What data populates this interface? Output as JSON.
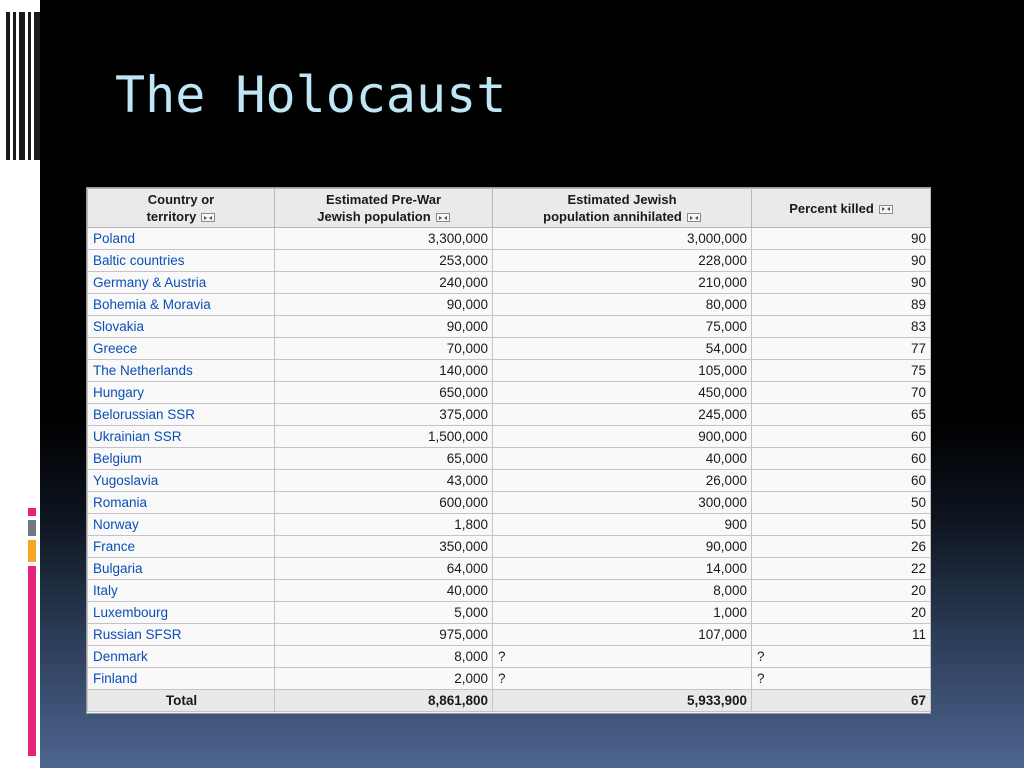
{
  "slide": {
    "title": "The Holocaust",
    "colors": {
      "title": "#bfe6f4",
      "accent_gray": "#6e7782",
      "accent_orange": "#f5a623",
      "accent_pink": "#e8247a",
      "link": "#0b4fb6"
    }
  },
  "table": {
    "headers": [
      {
        "line1": "Country or",
        "line2": "territory",
        "sortable": true
      },
      {
        "line1": "Estimated Pre-War",
        "line2": "Jewish population",
        "sortable": true
      },
      {
        "line1": "Estimated Jewish",
        "line2": "population annihilated",
        "sortable": true
      },
      {
        "line1": "Percent killed",
        "line2": "",
        "sortable": true
      }
    ],
    "sort_icon": "sort-toggle-icon",
    "rows": [
      {
        "country": "Poland",
        "prewar": "3,300,000",
        "annihilated": "3,000,000",
        "percent": "90"
      },
      {
        "country": "Baltic countries",
        "prewar": "253,000",
        "annihilated": "228,000",
        "percent": "90"
      },
      {
        "country": "Germany & Austria",
        "prewar": "240,000",
        "annihilated": "210,000",
        "percent": "90"
      },
      {
        "country": "Bohemia & Moravia",
        "prewar": "90,000",
        "annihilated": "80,000",
        "percent": "89"
      },
      {
        "country": "Slovakia",
        "prewar": "90,000",
        "annihilated": "75,000",
        "percent": "83"
      },
      {
        "country": "Greece",
        "prewar": "70,000",
        "annihilated": "54,000",
        "percent": "77"
      },
      {
        "country": "The Netherlands",
        "prewar": "140,000",
        "annihilated": "105,000",
        "percent": "75"
      },
      {
        "country": "Hungary",
        "prewar": "650,000",
        "annihilated": "450,000",
        "percent": "70"
      },
      {
        "country": "Belorussian SSR",
        "prewar": "375,000",
        "annihilated": "245,000",
        "percent": "65"
      },
      {
        "country": "Ukrainian SSR",
        "prewar": "1,500,000",
        "annihilated": "900,000",
        "percent": "60"
      },
      {
        "country": "Belgium",
        "prewar": "65,000",
        "annihilated": "40,000",
        "percent": "60"
      },
      {
        "country": "Yugoslavia",
        "prewar": "43,000",
        "annihilated": "26,000",
        "percent": "60"
      },
      {
        "country": "Romania",
        "prewar": "600,000",
        "annihilated": "300,000",
        "percent": "50"
      },
      {
        "country": "Norway",
        "prewar": "1,800",
        "annihilated": "900",
        "percent": "50"
      },
      {
        "country": "France",
        "prewar": "350,000",
        "annihilated": "90,000",
        "percent": "26"
      },
      {
        "country": "Bulgaria",
        "prewar": "64,000",
        "annihilated": "14,000",
        "percent": "22"
      },
      {
        "country": "Italy",
        "prewar": "40,000",
        "annihilated": "8,000",
        "percent": "20"
      },
      {
        "country": "Luxembourg",
        "prewar": "5,000",
        "annihilated": "1,000",
        "percent": "20"
      },
      {
        "country": "Russian SFSR",
        "prewar": "975,000",
        "annihilated": "107,000",
        "percent": "11"
      },
      {
        "country": "Denmark",
        "prewar": "8,000",
        "annihilated": "?",
        "percent": "?"
      },
      {
        "country": "Finland",
        "prewar": "2,000",
        "annihilated": "?",
        "percent": "?"
      }
    ],
    "total": {
      "label": "Total",
      "prewar": "8,861,800",
      "annihilated": "5,933,900",
      "percent": "67"
    }
  }
}
